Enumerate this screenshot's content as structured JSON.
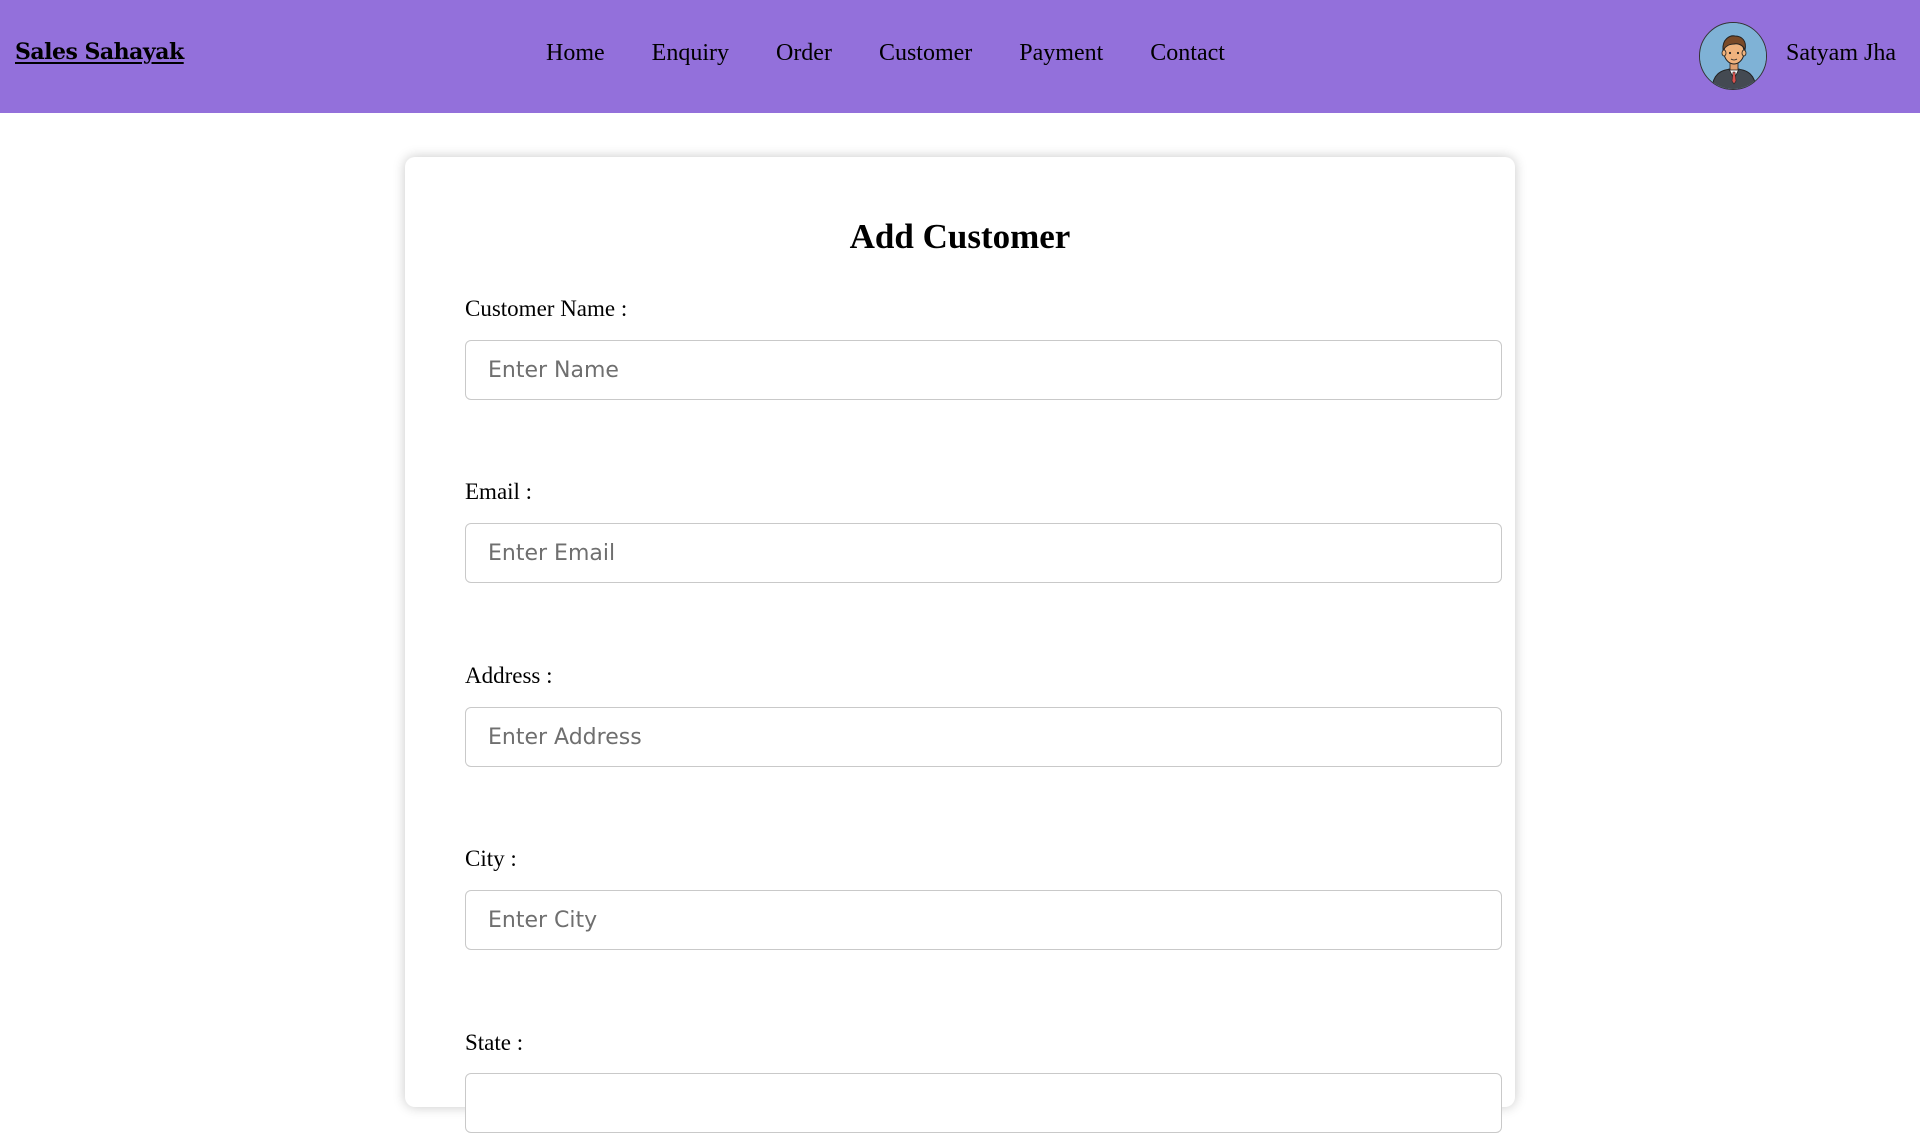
{
  "navbar": {
    "brand": "Sales Sahayak",
    "links": [
      {
        "label": "Home"
      },
      {
        "label": "Enquiry"
      },
      {
        "label": "Order"
      },
      {
        "label": "Customer"
      },
      {
        "label": "Payment"
      },
      {
        "label": "Contact"
      }
    ],
    "user_name": "Satyam Jha",
    "avatar_icon": "user-avatar-icon",
    "background_color": "#9370db"
  },
  "form": {
    "title": "Add Customer",
    "fields": [
      {
        "label": "Customer Name :",
        "placeholder": "Enter Name",
        "value": ""
      },
      {
        "label": "Email :",
        "placeholder": "Enter Email",
        "value": ""
      },
      {
        "label": "Address :",
        "placeholder": "Enter Address",
        "value": ""
      },
      {
        "label": "City :",
        "placeholder": "Enter City",
        "value": ""
      },
      {
        "label": "State :",
        "placeholder": "",
        "value": ""
      }
    ]
  }
}
